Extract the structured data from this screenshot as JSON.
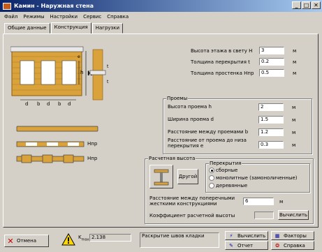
{
  "window": {
    "title": "Камин - Наружная стена",
    "min": "_",
    "max": "□",
    "close": "✕"
  },
  "menu": [
    "Файл",
    "Режимы",
    "Настройки",
    "Сервис",
    "Справка"
  ],
  "tabs": [
    "Общие данные",
    "Конструкция",
    "Нагрузки"
  ],
  "fields": {
    "floor_height": {
      "label": "Высота этажа в свету H",
      "value": "3",
      "unit": "м"
    },
    "slab_thickness": {
      "label": "Толщина перекрытия t",
      "value": "0.2",
      "unit": "м"
    },
    "pier_thickness": {
      "label": "Толщина простенка Hпр",
      "value": "0.5",
      "unit": "м"
    }
  },
  "openings": {
    "title": "Проемы",
    "height": {
      "label": "Высота проема h",
      "value": "2",
      "unit": "м"
    },
    "width": {
      "label": "Ширина проема d",
      "value": "1.5",
      "unit": "м"
    },
    "spacing": {
      "label": "Расстояние между проемами b",
      "value": "1.2",
      "unit": "м"
    },
    "to_slab_line1": "Расстояние от проема до низа",
    "to_slab_line2": "перекрытия e",
    "to_slab_value": "0.3",
    "to_slab_unit": "м"
  },
  "diagram": {
    "labels": {
      "h": "h",
      "H": "H",
      "t": "t",
      "e": "e",
      "d": "d",
      "b": "b"
    },
    "hpr1": "Hпр",
    "hpr2": "Hпр"
  },
  "calc_height": {
    "title": "Расчетная высота",
    "other_button": "Другой",
    "slabs_title": "Перекрытия",
    "slab_options": [
      "сборные",
      "монолитные (замоноличенные)",
      "деревянные"
    ],
    "selected": 0,
    "distance_line1": "Расстояние между поперечными",
    "distance_line2": "жесткими конструкциями",
    "distance_value": "6",
    "distance_unit": "м",
    "coef_label": "Коэффициент расчетной высоты",
    "coef_value": "",
    "calc_button": "Вычислить"
  },
  "statusbar": {
    "cancel": "Отмена",
    "k_label": "K",
    "k_sub": "max",
    "k_eq": "=",
    "k_value": "2.138",
    "message": "Раскрытие швов кладки",
    "calc": "Вычислить",
    "factors": "Факторы",
    "report": "Отчет",
    "help": "Справка"
  },
  "colors": {
    "brick": "#d9a23b",
    "brick_dark": "#b07a1e",
    "title_from": "#0a246a",
    "title_to": "#a6caf0"
  }
}
